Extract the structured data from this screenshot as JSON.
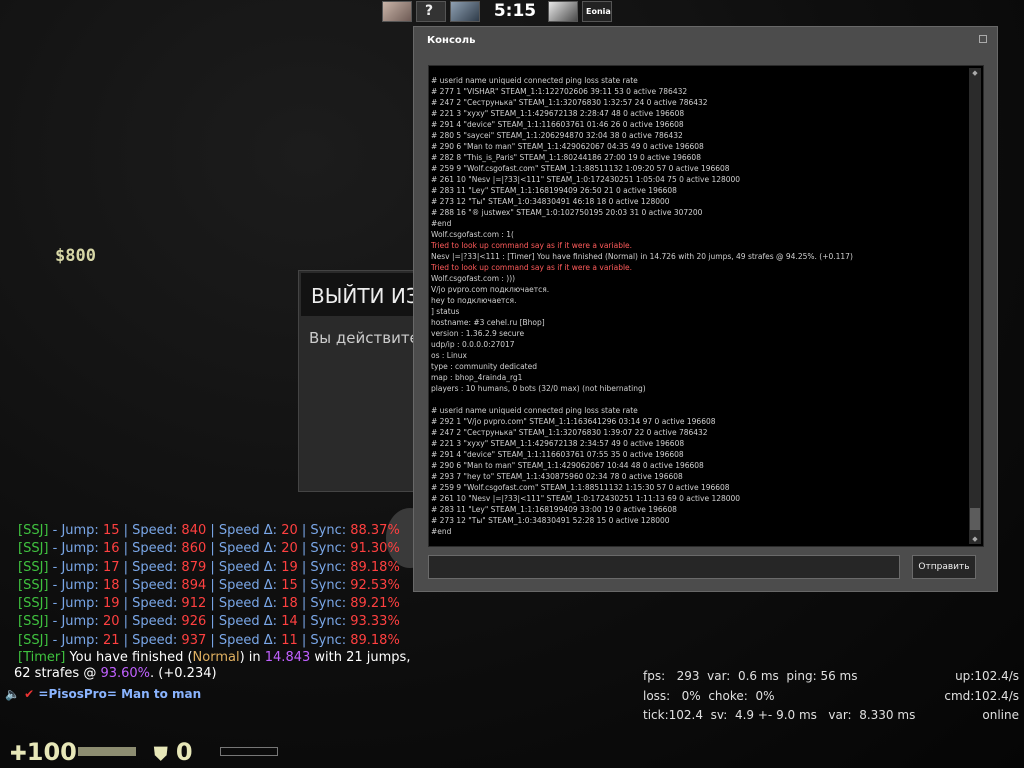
{
  "hud": {
    "round_time": "5:15",
    "money": "$800",
    "health": "100",
    "armor": "0",
    "avatar_question": "?",
    "avatar_label": "Eonia"
  },
  "quit_dialog": {
    "title": "ВЫЙТИ ИЗ",
    "text": "Вы действите"
  },
  "console": {
    "title": "Консоль",
    "send_label": "Отправить",
    "input_value": "",
    "lines": [
      {
        "t": "# userid name uniqueid connected ping loss state rate",
        "e": false
      },
      {
        "t": "# 277 1 \"VISHAR\" STEAM_1:1:122702606 39:11 53 0 active 786432",
        "e": false
      },
      {
        "t": "# 247 2 \"Сеструнька\" STEAM_1:1:32076830 1:32:57 24 0 active 786432",
        "e": false
      },
      {
        "t": "# 221 3 \"хухy\" STEAM_1:1:429672138 2:28:47 48 0 active 196608",
        "e": false
      },
      {
        "t": "# 291 4 \"device\" STEAM_1:1:116603761 01:46 26 0 active 196608",
        "e": false
      },
      {
        "t": "# 280 5 \"saycei\" STEAM_1:1:206294870 32:04 38 0 active 786432",
        "e": false
      },
      {
        "t": "# 290 6 \"Man to man\" STEAM_1:1:429062067 04:35 49 0 active 196608",
        "e": false
      },
      {
        "t": "# 282 8 \"This_is_Paris\" STEAM_1:1:80244186 27:00 19 0 active 196608",
        "e": false
      },
      {
        "t": "# 259 9 \"Wolf.csgofast.com\" STEAM_1:1:88511132 1:09:20 57 0 active 196608",
        "e": false
      },
      {
        "t": "# 261 10 \"Nesv |=|?33|<111\" STEAM_1:0:172430251 1:05:04 75 0 active 128000",
        "e": false
      },
      {
        "t": "# 283 11 \"Ley\" STEAM_1:1:168199409 26:50 21 0 active 196608",
        "e": false
      },
      {
        "t": "# 273 12 \"Ты\" STEAM_1:0:34830491 46:18 18 0 active 128000",
        "e": false
      },
      {
        "t": "# 288 16 \"® justwex\" STEAM_1:0:102750195 20:03 31 0 active 307200",
        "e": false
      },
      {
        "t": "#end",
        "e": false
      },
      {
        "t": "Wolf.csgofast.com : 1(",
        "e": false
      },
      {
        "t": "Tried to look up command say as if it were a variable.",
        "e": true
      },
      {
        "t": "Nesv |=|?33|<111 :  [Timer] You have finished (Normal) in 14.726 with 20 jumps, 49 strafes @ 94.25%. (+0.117)",
        "e": false
      },
      {
        "t": "Tried to look up command say as if it were a variable.",
        "e": true
      },
      {
        "t": "Wolf.csgofast.com : )))",
        "e": false
      },
      {
        "t": "V/jo pvpro.com подключается.",
        "e": false
      },
      {
        "t": "hey to подключается.",
        "e": false
      },
      {
        "t": "] status",
        "e": false
      },
      {
        "t": "hostname: #3 cehel.ru [Bhop]",
        "e": false
      },
      {
        "t": "version : 1.36.2.9 secure",
        "e": false
      },
      {
        "t": "udp/ip  : 0.0.0.0:27017",
        "e": false
      },
      {
        "t": "os      :  Linux",
        "e": false
      },
      {
        "t": "type    :  community dedicated",
        "e": false
      },
      {
        "t": "map     :  bhop_4rainda_rg1",
        "e": false
      },
      {
        "t": "players : 10 humans, 0 bots (32/0 max) (not hibernating)",
        "e": false
      },
      {
        "t": "",
        "e": false
      },
      {
        "t": "# userid name uniqueid connected ping loss state rate",
        "e": false
      },
      {
        "t": "# 292 1 \"V/jo pvpro.com\" STEAM_1:1:163641296 03:14 97 0 active 196608",
        "e": false
      },
      {
        "t": "# 247 2 \"Сеструнька\" STEAM_1:1:32076830 1:39:07 22 0 active 786432",
        "e": false
      },
      {
        "t": "# 221 3 \"хухy\" STEAM_1:1:429672138 2:34:57 49 0 active 196608",
        "e": false
      },
      {
        "t": "# 291 4 \"device\" STEAM_1:1:116603761 07:55 35 0 active 196608",
        "e": false
      },
      {
        "t": "# 290 6 \"Man to man\" STEAM_1:1:429062067 10:44 48 0 active 196608",
        "e": false
      },
      {
        "t": "# 293 7 \"hey to\" STEAM_1:1:430875960 02:34 78 0 active 196608",
        "e": false
      },
      {
        "t": "# 259 9 \"Wolf.csgofast.com\" STEAM_1:1:88511132 1:15:30 57 0 active 196608",
        "e": false
      },
      {
        "t": "# 261 10 \"Nesv |=|?33|<111\" STEAM_1:0:172430251 1:11:13 69 0 active 128000",
        "e": false
      },
      {
        "t": "# 283 11 \"Ley\" STEAM_1:1:168199409 33:00 19 0 active 196608",
        "e": false
      },
      {
        "t": "# 273 12 \"Ты\" STEAM_1:0:34830491 52:28 15 0 active 128000",
        "e": false
      },
      {
        "t": "#end",
        "e": false
      }
    ]
  },
  "chat": {
    "rows": [
      {
        "tag": "[SSJ]",
        "jump_lbl": " - Jump: ",
        "jump": "15",
        "speed_lbl": " | Speed: ",
        "speed": "840",
        "delta_lbl": " | Speed Δ: ",
        "delta": "20",
        "sync_lbl": " | Sync: ",
        "sync": "88.37%"
      },
      {
        "tag": "[SSJ]",
        "jump_lbl": " - Jump: ",
        "jump": "16",
        "speed_lbl": " | Speed: ",
        "speed": "860",
        "delta_lbl": " | Speed Δ: ",
        "delta": "20",
        "sync_lbl": " | Sync: ",
        "sync": "91.30%"
      },
      {
        "tag": "[SSJ]",
        "jump_lbl": " - Jump: ",
        "jump": "17",
        "speed_lbl": " | Speed: ",
        "speed": "879",
        "delta_lbl": " | Speed Δ: ",
        "delta": "19",
        "sync_lbl": " | Sync: ",
        "sync": "89.18%"
      },
      {
        "tag": "[SSJ]",
        "jump_lbl": " - Jump: ",
        "jump": "18",
        "speed_lbl": " | Speed: ",
        "speed": "894",
        "delta_lbl": " | Speed Δ: ",
        "delta": "15",
        "sync_lbl": " | Sync: ",
        "sync": "92.53%"
      },
      {
        "tag": "[SSJ]",
        "jump_lbl": " - Jump: ",
        "jump": "19",
        "speed_lbl": " | Speed: ",
        "speed": "912",
        "delta_lbl": " | Speed Δ: ",
        "delta": "18",
        "sync_lbl": " | Sync: ",
        "sync": "89.21%"
      },
      {
        "tag": "[SSJ]",
        "jump_lbl": " - Jump: ",
        "jump": "20",
        "speed_lbl": " | Speed: ",
        "speed": "926",
        "delta_lbl": " | Speed Δ: ",
        "delta": "14",
        "sync_lbl": " | Sync: ",
        "sync": "93.33%"
      },
      {
        "tag": "[SSJ]",
        "jump_lbl": " - Jump: ",
        "jump": "21",
        "speed_lbl": " | Speed: ",
        "speed": "937",
        "delta_lbl": " | Speed Δ: ",
        "delta": "11",
        "sync_lbl": " | Sync: ",
        "sync": "89.18%"
      }
    ],
    "timer": {
      "tag": "[Timer]",
      "part1": " You have finished (",
      "style": "Normal",
      "part2": ") in ",
      "time": "14.843",
      "part3": " with 21 jumps,",
      "line2_a": "62 strafes @ ",
      "pct": "93.60%",
      "line2_b": ". (+0.234)"
    },
    "killfeed": "=PisosPro= Man to man"
  },
  "netgraph": {
    "row1_left": "fps:   293  var:  0.6 ms  ping: 56 ms",
    "row1_right": "up:102.4/s",
    "row2_left": "loss:   0%  choke:  0%",
    "row2_right": "cmd:102.4/s",
    "row3_left": "tick:102.4  sv:  4.9 +- 9.0 ms   var:  8.330 ms",
    "row3_right": "online"
  },
  "colors": {
    "ssj_tag": "#3fc23f",
    "label": "#7aa7e8",
    "value": "#ff4040",
    "console_error": "#ff5b5b"
  }
}
